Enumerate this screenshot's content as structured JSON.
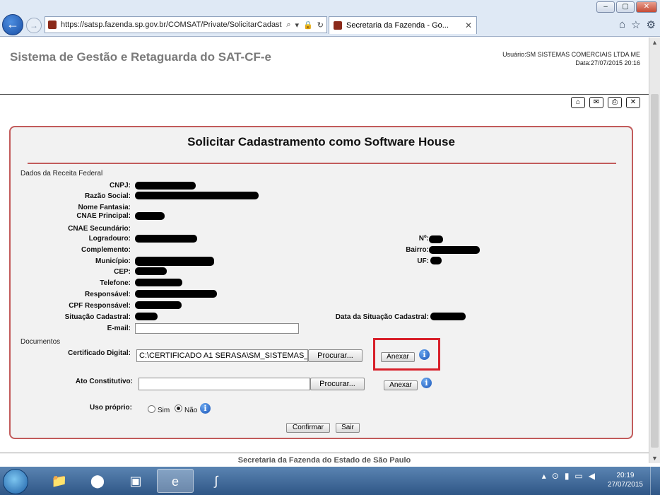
{
  "browser": {
    "url": "https://satsp.fazenda.sp.gov.br/COMSAT/Private/SolicitarCadast",
    "tab_title": "Secretaria da Fazenda - Go...",
    "window_controls": {
      "minimize": "–",
      "maximize": "▢",
      "close": "✕"
    },
    "icons": [
      "home-icon",
      "star-icon",
      "gear-icon"
    ]
  },
  "header": {
    "system_title": "Sistema de Gestão e Retaguarda do SAT-CF-e",
    "user_line": "Usuário:SM SISTEMAS COMERCIAIS LTDA ME",
    "date_line": "Data:27/07/2015 20:16"
  },
  "form": {
    "title": "Solicitar Cadastramento como Software House",
    "section_receita": "Dados da Receita Federal",
    "labels": {
      "cnpj": "CNPJ:",
      "razao_social": "Razão Social:",
      "nome_fantasia": "Nome Fantasia:",
      "cnae_principal": "CNAE Principal:",
      "cnae_secundario": "CNAE Secundário:",
      "logradouro": "Logradouro:",
      "numero": "Nº:",
      "complemento": "Complemento:",
      "bairro": "Bairro:",
      "municipio": "Município:",
      "uf": "UF:",
      "cep": "CEP:",
      "telefone": "Telefone:",
      "responsavel": "Responsável:",
      "cpf_responsavel": "CPF Responsável:",
      "situacao_cadastral": "Situação Cadastral:",
      "data_situacao": "Data da Situação Cadastral:",
      "email": "E-mail:"
    },
    "email_value": "",
    "section_documentos": "Documentos",
    "certificado_label": "Certificado Digital:",
    "certificado_value": "C:\\CERTIFICADO A1 SERASA\\SM_SISTEMAS_",
    "ato_label": "Ato Constitutivo:",
    "ato_value": "",
    "procurar": "Procurar...",
    "anexar": "Anexar",
    "uso_proprio_label": "Uso próprio:",
    "sim": "Sim",
    "nao": "Não",
    "uso_proprio_selected": "Não",
    "confirmar": "Confirmar",
    "sair": "Sair"
  },
  "footer": {
    "text": "Secretaria da Fazenda do Estado de São Paulo"
  },
  "taskbar": {
    "time": "20:19",
    "date": "27/07/2015"
  },
  "colors": {
    "panel_border": "#c25b5b",
    "highlight": "#d8202a",
    "taskbar": "#3b6496"
  }
}
